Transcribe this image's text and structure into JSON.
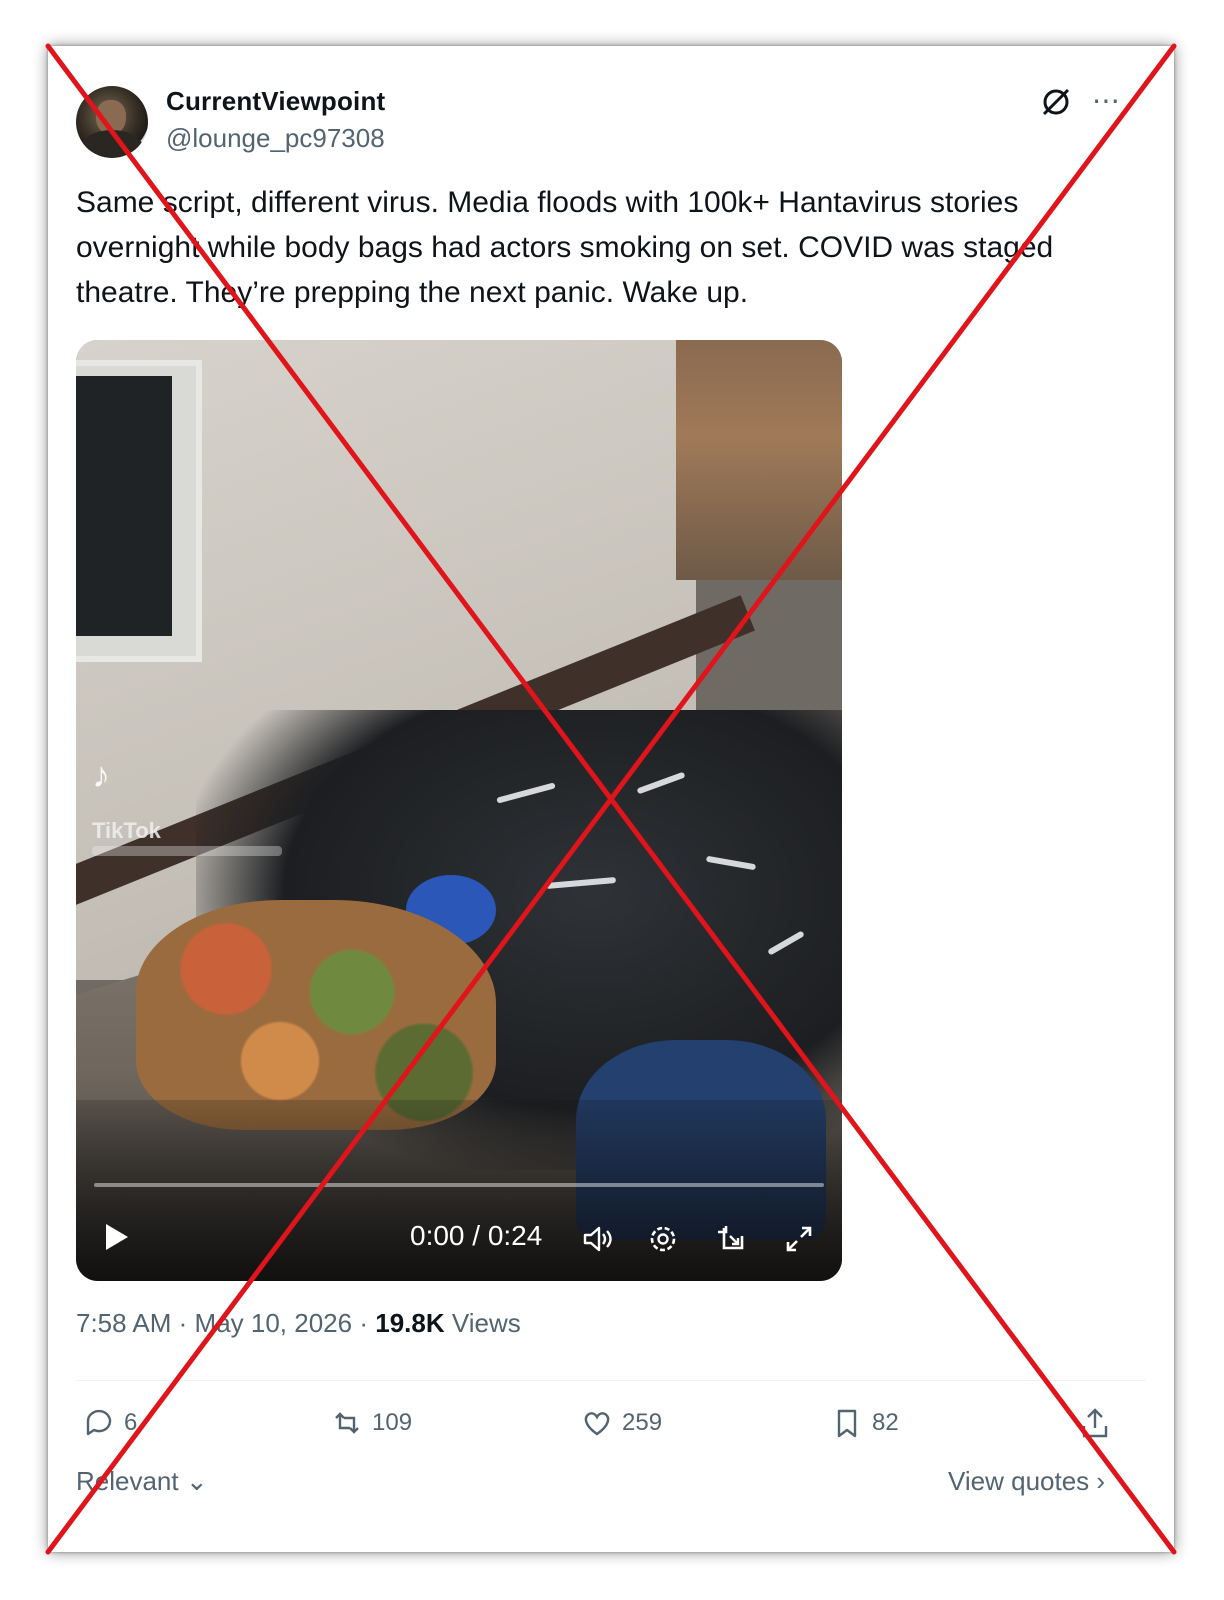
{
  "post": {
    "display_name": "CurrentViewpoint",
    "handle": "@lounge_pc97308",
    "text": "Same script, different virus. Media floods with 100k+ Hantavirus stories overnight while body bags had actors smoking on set. COVID was staged theatre. They’re prepping the next panic. Wake up.",
    "time": "7:58 AM",
    "separator": "·",
    "date": "May 10, 2026",
    "views_count": "19.8K",
    "views_label": "Views"
  },
  "video": {
    "watermark_label": "TikTok",
    "time_display": "0:00 / 0:24",
    "progress_fraction": 0.0
  },
  "actions": {
    "replies": "6",
    "reposts": "109",
    "likes": "259",
    "bookmarks": "82"
  },
  "footer": {
    "sort_label": "Relevant",
    "view_quotes_label": "View quotes"
  },
  "icons": [
    "grok-icon",
    "more-icon",
    "play-icon",
    "volume-icon",
    "settings-icon",
    "pip-icon",
    "fullscreen-icon",
    "reply-icon",
    "repost-icon",
    "like-icon",
    "bookmark-icon",
    "share-icon"
  ],
  "colors": {
    "text_primary": "#0f1419",
    "text_secondary": "#536471",
    "cross_overlay": "#e0141b"
  }
}
